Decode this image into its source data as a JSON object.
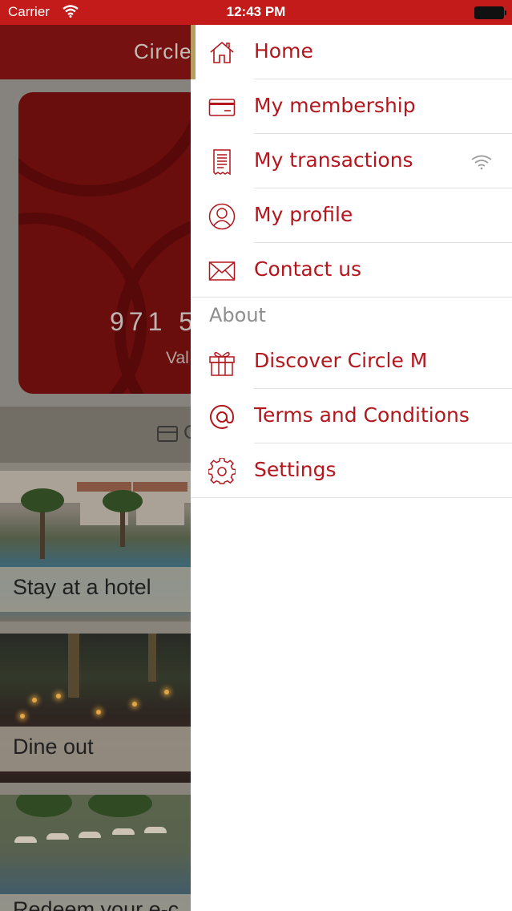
{
  "status_bar": {
    "carrier": "Carrier",
    "time": "12:43 PM"
  },
  "background": {
    "header_title": "Circle",
    "card_number": "971 5",
    "card_valid": "Val",
    "strip_text": "C",
    "tiles": [
      {
        "label": "Stay at a hotel"
      },
      {
        "label": "Dine out"
      },
      {
        "label": "Redeem your e-c"
      }
    ]
  },
  "menu": {
    "items": [
      {
        "label": "Home",
        "icon": "home-icon"
      },
      {
        "label": "My membership",
        "icon": "membership-card-icon"
      },
      {
        "label": "My transactions",
        "icon": "receipt-icon"
      },
      {
        "label": "My profile",
        "icon": "profile-icon"
      },
      {
        "label": "Contact us",
        "icon": "envelope-icon"
      }
    ],
    "section_title": "About",
    "about_items": [
      {
        "label": "Discover Circle M",
        "icon": "gift-icon"
      },
      {
        "label": "Terms and Conditions",
        "icon": "at-sign-icon"
      },
      {
        "label": "Settings",
        "icon": "gear-icon"
      }
    ]
  },
  "colors": {
    "accent_red": "#b3161c",
    "status_bar_red": "#c31a1a",
    "active_indicator_gold": "#b99d60"
  }
}
